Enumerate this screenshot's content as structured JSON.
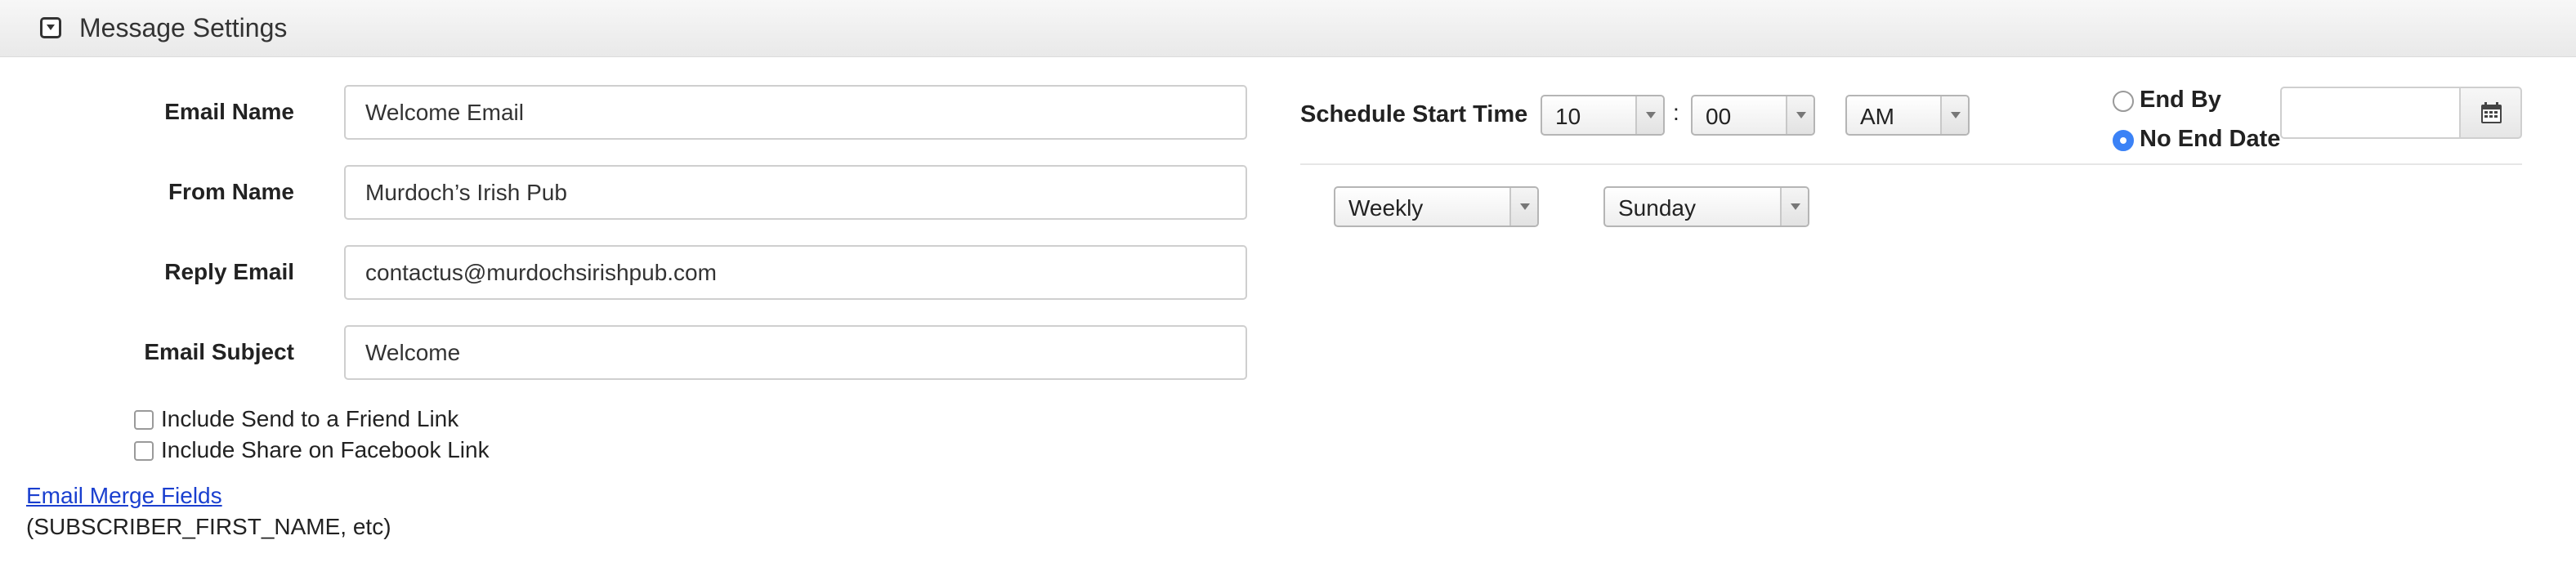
{
  "header": {
    "title": "Message Settings",
    "collapse_icon": "collapse-icon"
  },
  "form": {
    "email_name": {
      "label": "Email Name",
      "value": "Welcome Email"
    },
    "from_name": {
      "label": "From Name",
      "value": "Murdoch’s Irish Pub"
    },
    "reply_email": {
      "label": "Reply Email",
      "value": "contactus@murdochsirishpub.com"
    },
    "email_subject": {
      "label": "Email Subject",
      "value": "Welcome"
    }
  },
  "options": {
    "send_to_friend": {
      "label": "Include Send to a Friend Link",
      "checked": false
    },
    "share_facebook": {
      "label": "Include Share on Facebook Link",
      "checked": false
    }
  },
  "merge": {
    "link_text": "Email Merge Fields",
    "note": "(SUBSCRIBER_FIRST_NAME, etc)"
  },
  "schedule": {
    "label": "Schedule Start Time",
    "hour": "10",
    "separator": ":",
    "minute": "00",
    "ampm": "AM",
    "end_by_label": "End By",
    "no_end_date_label": "No End Date",
    "selected_end_option": "No End Date",
    "end_date_value": "",
    "calendar_icon": "calendar-icon",
    "frequency": "Weekly",
    "day": "Sunday"
  },
  "colors": {
    "link": "#1a3fcf",
    "radio_selected": "#3b82f6"
  }
}
